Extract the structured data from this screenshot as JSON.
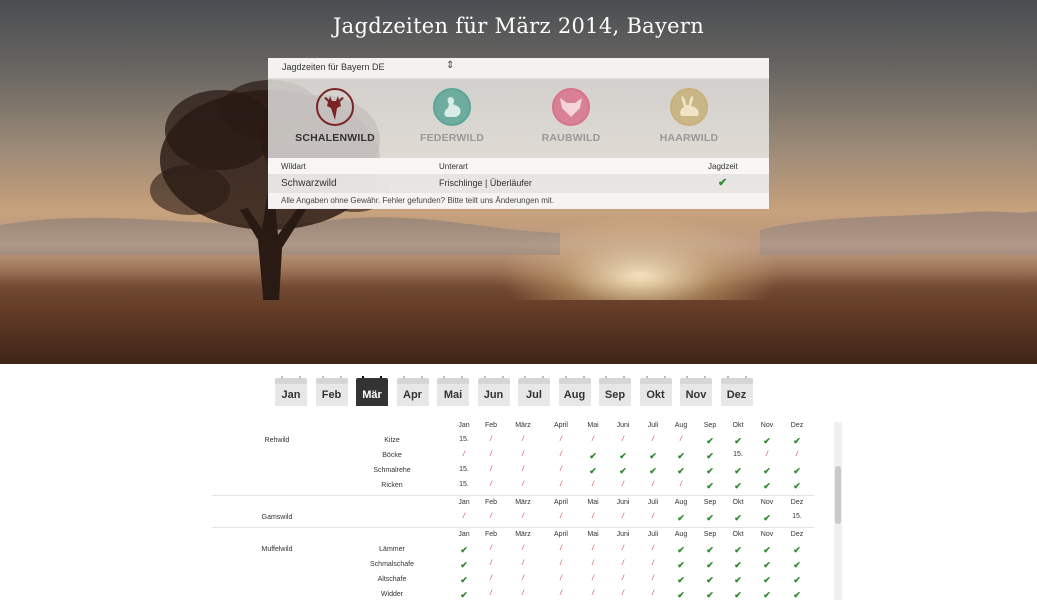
{
  "title": "Jagdzeiten für März 2014, Bayern",
  "selector": {
    "value": "Jagdzeiten für Bayern DE",
    "icon": "up-down-arrows-icon"
  },
  "categories": [
    {
      "label": "SCHALENWILD",
      "icon": "deer-icon",
      "color": "#7a2424",
      "active": true
    },
    {
      "label": "FEDERWILD",
      "icon": "duck-icon",
      "color": "#5aa595",
      "active": false
    },
    {
      "label": "RAUBWILD",
      "icon": "fox-icon",
      "color": "#d8728b",
      "active": false
    },
    {
      "label": "HAARWILD",
      "icon": "hare-icon",
      "color": "#c7b07a",
      "active": false
    }
  ],
  "result_table": {
    "headers": {
      "wildart": "Wildart",
      "unterart": "Unterart",
      "jagdzeit": "Jagdzeit"
    },
    "rows": [
      {
        "wildart": "Schwarzwild",
        "unterart": "Frischlinge | Überläufer",
        "jagdzeit": "✔"
      }
    ],
    "footer": "Alle Angaben ohne Gewähr. Fehler gefunden? Bitte teilt uns Änderungen mit."
  },
  "months": [
    "Jan",
    "Feb",
    "Mär",
    "Apr",
    "Mai",
    "Jun",
    "Jul",
    "Aug",
    "Sep",
    "Okt",
    "Nov",
    "Dez"
  ],
  "active_month": "Mär",
  "season_header": [
    "Jan",
    "Feb",
    "März",
    "April",
    "Mai",
    "Juni",
    "Juli",
    "Aug",
    "Sep",
    "Okt",
    "Nov",
    "Dez"
  ],
  "season_groups": [
    {
      "species": "Rehwild",
      "rows": [
        {
          "sub": "Kitze",
          "cells": [
            "15.",
            "/",
            "/",
            "/",
            "/",
            "/",
            "/",
            "/",
            "✔",
            "✔",
            "✔",
            "✔"
          ]
        },
        {
          "sub": "Böcke",
          "cells": [
            "/",
            "/",
            "/",
            "/",
            "✔",
            "✔",
            "✔",
            "✔",
            "✔",
            "15.",
            "/",
            "/"
          ]
        },
        {
          "sub": "Schmalrehe",
          "cells": [
            "15.",
            "/",
            "/",
            "/",
            "✔",
            "✔",
            "✔",
            "✔",
            "✔",
            "✔",
            "✔",
            "✔"
          ]
        },
        {
          "sub": "Ricken",
          "cells": [
            "15.",
            "/",
            "/",
            "/",
            "/",
            "/",
            "/",
            "/",
            "✔",
            "✔",
            "✔",
            "✔"
          ]
        }
      ]
    },
    {
      "species": "Gamswild",
      "rows": [
        {
          "sub": "",
          "cells": [
            "/",
            "/",
            "/",
            "/",
            "/",
            "/",
            "/",
            "✔",
            "✔",
            "✔",
            "✔",
            "15."
          ]
        }
      ]
    },
    {
      "species": "Muffelwild",
      "rows": [
        {
          "sub": "Lämmer",
          "cells": [
            "✔",
            "/",
            "/",
            "/",
            "/",
            "/",
            "/",
            "✔",
            "✔",
            "✔",
            "✔",
            "✔"
          ]
        },
        {
          "sub": "Schmalschafe",
          "cells": [
            "✔",
            "/",
            "/",
            "/",
            "/",
            "/",
            "/",
            "✔",
            "✔",
            "✔",
            "✔",
            "✔"
          ]
        },
        {
          "sub": "Altschafe",
          "cells": [
            "✔",
            "/",
            "/",
            "/",
            "/",
            "/",
            "/",
            "✔",
            "✔",
            "✔",
            "✔",
            "✔"
          ]
        },
        {
          "sub": "Widder",
          "cells": [
            "✔",
            "/",
            "/",
            "/",
            "/",
            "/",
            "/",
            "✔",
            "✔",
            "✔",
            "✔",
            "✔"
          ]
        }
      ]
    }
  ],
  "colors": {
    "check": "#2f8a2f",
    "slash": "#d3413b",
    "active_month_bg": "#333333"
  }
}
